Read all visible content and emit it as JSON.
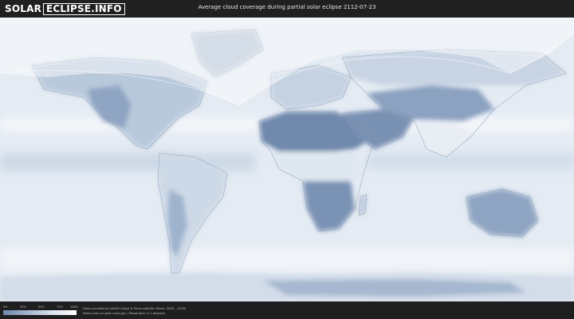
{
  "header": {
    "logo_part1": "SOLAR",
    "logo_part2": "ECLIPSE.INFO",
    "title": "Average cloud coverage during partial solar eclipse 2112-07-23"
  },
  "legend": {
    "ticks": [
      "0%",
      "25%",
      "50%",
      "75%",
      "100%"
    ],
    "colors": [
      "#6d87ab",
      "#a4b6cf",
      "#dbe3ee",
      "#ffffff"
    ]
  },
  "credits": {
    "line1": "Data provided by NASA's Aqua & Terra satellite (Years: 2000 - 2019)",
    "line2": "https://neo.sci.gsfc.nasa.gov | Resolution: 0.1 degrees"
  },
  "colors": {
    "background": "#1f1f1f",
    "ocean_base": "#dfe7f0",
    "clear_sky": "#6d87ab",
    "full_cloud": "#ffffff",
    "outside_eclipse": "#cfd6de"
  }
}
